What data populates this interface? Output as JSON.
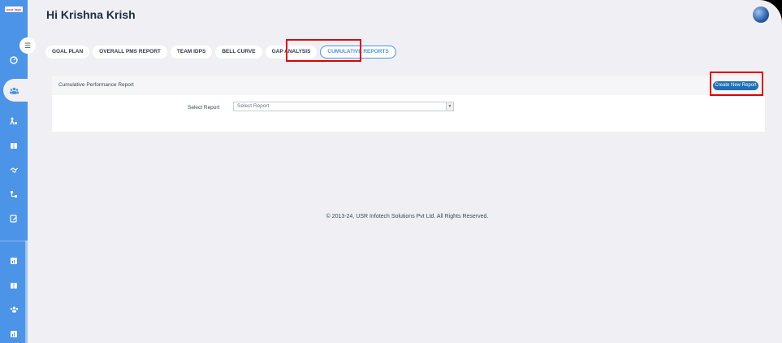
{
  "sidebar": {
    "logo_text": "your logo",
    "icons": [
      "dashboard-icon",
      "team-icon",
      "org-icon",
      "book-icon",
      "handshake-icon",
      "hierarchy-icon",
      "edit-icon",
      "chart-icon",
      "book-icon-2",
      "users-icon",
      "report-icon"
    ]
  },
  "header": {
    "greeting": "Hi Krishna Krish"
  },
  "tabs": [
    {
      "label": "GOAL PLAN"
    },
    {
      "label": "OVERALL PMS REPORT"
    },
    {
      "label": "TEAM IDPS"
    },
    {
      "label": "BELL CURVE"
    },
    {
      "label": "GAP ANALYSIS"
    },
    {
      "label": "CUMULATIVE REPORTS",
      "active": true
    }
  ],
  "card": {
    "title": "Cumulative Performance Report",
    "create_button": "Create New Report",
    "select_label": "Select Report",
    "select_value": "Select Report"
  },
  "footer": {
    "text": "© 2013-24, USR Infotech Solutions Pvt Ltd. All Rights Reserved."
  },
  "colors": {
    "accent": "#4c94e8",
    "highlight": "#e00000",
    "button": "#1e6fb5"
  }
}
